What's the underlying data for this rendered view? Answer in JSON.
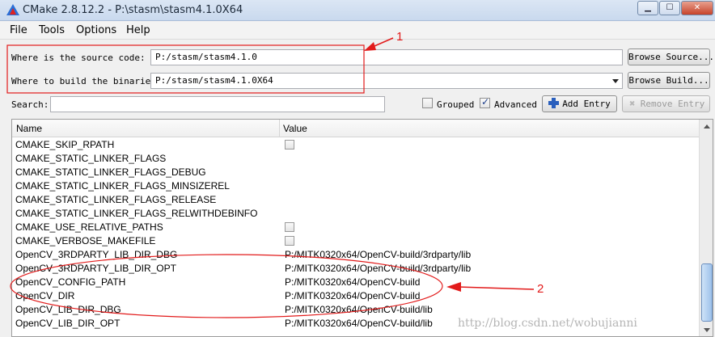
{
  "window": {
    "title": "CMake 2.8.12.2 - P:\\stasm\\stasm4.1.0X64"
  },
  "menu": {
    "items": [
      "File",
      "Tools",
      "Options",
      "Help"
    ]
  },
  "source": {
    "label": "Where is the source code:",
    "value": "P:/stasm/stasm4.1.0",
    "button": "Browse Source..."
  },
  "build": {
    "label": "Where to build the binaries:",
    "value": "P:/stasm/stasm4.1.0X64",
    "button": "Browse Build..."
  },
  "search": {
    "label": "Search:",
    "value": ""
  },
  "options": {
    "grouped_label": "Grouped",
    "grouped_checked": false,
    "advanced_label": "Advanced",
    "advanced_checked": true
  },
  "actions": {
    "add_entry": "Add Entry",
    "remove_entry": "Remove Entry"
  },
  "table": {
    "headers": [
      "Name",
      "Value"
    ],
    "rows": [
      {
        "name": "CMAKE_SKIP_RPATH",
        "value": "",
        "type": "bool"
      },
      {
        "name": "CMAKE_STATIC_LINKER_FLAGS",
        "value": "",
        "type": "string"
      },
      {
        "name": "CMAKE_STATIC_LINKER_FLAGS_DEBUG",
        "value": "",
        "type": "string"
      },
      {
        "name": "CMAKE_STATIC_LINKER_FLAGS_MINSIZEREL",
        "value": "",
        "type": "string"
      },
      {
        "name": "CMAKE_STATIC_LINKER_FLAGS_RELEASE",
        "value": "",
        "type": "string"
      },
      {
        "name": "CMAKE_STATIC_LINKER_FLAGS_RELWITHDEBINFO",
        "value": "",
        "type": "string"
      },
      {
        "name": "CMAKE_USE_RELATIVE_PATHS",
        "value": "",
        "type": "bool"
      },
      {
        "name": "CMAKE_VERBOSE_MAKEFILE",
        "value": "",
        "type": "bool"
      },
      {
        "name": "OpenCV_3RDPARTY_LIB_DIR_DBG",
        "value": "P:/MITK0320x64/OpenCV-build/3rdparty/lib",
        "type": "string"
      },
      {
        "name": "OpenCV_3RDPARTY_LIB_DIR_OPT",
        "value": "P:/MITK0320x64/OpenCV-build/3rdparty/lib",
        "type": "string"
      },
      {
        "name": "OpenCV_CONFIG_PATH",
        "value": "P:/MITK0320x64/OpenCV-build",
        "type": "string"
      },
      {
        "name": "OpenCV_DIR",
        "value": "P:/MITK0320x64/OpenCV-build",
        "type": "string"
      },
      {
        "name": "OpenCV_LIB_DIR_DBG",
        "value": "P:/MITK0320x64/OpenCV-build/lib",
        "type": "string"
      },
      {
        "name": "OpenCV_LIB_DIR_OPT",
        "value": "P:/MITK0320x64/OpenCV-build/lib",
        "type": "string"
      }
    ]
  },
  "annotations": {
    "marker1": "1",
    "marker2": "2",
    "color": "#e21b1b"
  },
  "watermark": "http://blog.csdn.net/wobujianni"
}
